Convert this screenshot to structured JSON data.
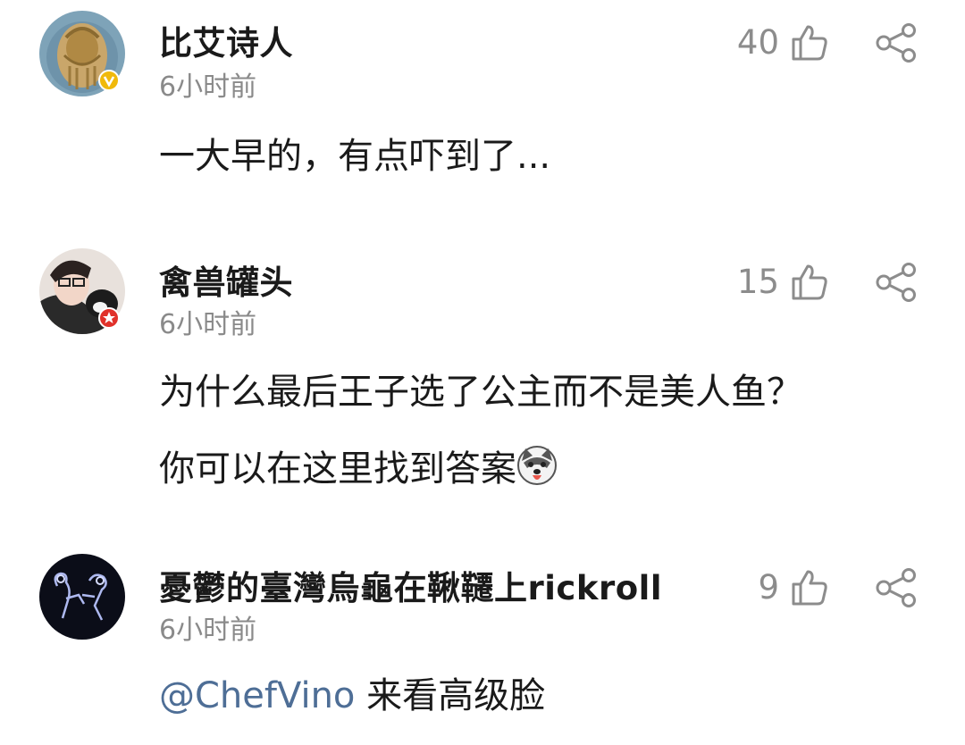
{
  "comments": [
    {
      "username": "比艾诗人",
      "time": "6小时前",
      "likes": "40",
      "badge": "gold-v-badge",
      "badge_color": "#f0b90b",
      "lines": [
        "一大早的，有点吓到了..."
      ]
    },
    {
      "username": "禽兽罐头",
      "time": "6小时前",
      "likes": "15",
      "badge": "red-star-badge",
      "badge_color": "#e0312a",
      "lines": [
        "为什么最后王子选了公主而不是美人鱼？",
        "你可以在这里找到答案"
      ],
      "emoji": "husky-dog-emoji"
    },
    {
      "username": "憂鬱的臺灣烏龜在鞦韆上rickroll",
      "time": "6小时前",
      "likes": "9",
      "mention": "@ChefVino",
      "lines": [
        " 来看高级脸"
      ]
    }
  ],
  "colors": {
    "text": "#1a1a1a",
    "meta": "#8a8a8a",
    "mention": "#4e6e96",
    "icon": "#8c8c8c"
  }
}
